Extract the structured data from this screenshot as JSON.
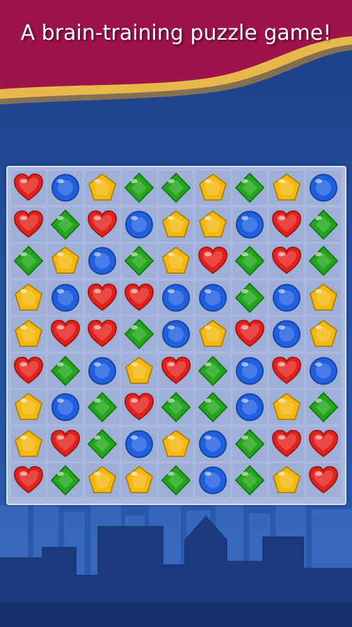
{
  "banner": {
    "tagline": "A brain-training puzzle game!",
    "colors": {
      "ribbon": "#a0124a",
      "gold": "#e8b84a"
    }
  },
  "board": {
    "rows": 9,
    "cols": 9,
    "grid": [
      [
        "heart",
        "circle",
        "pentagon",
        "diamond",
        "diamond",
        "pentagon",
        "diamond",
        "pentagon",
        "circle"
      ],
      [
        "heart",
        "diamond",
        "heart",
        "circle",
        "pentagon",
        "pentagon",
        "circle",
        "heart",
        "diamond"
      ],
      [
        "diamond",
        "pentagon",
        "circle",
        "diamond",
        "pentagon",
        "heart",
        "diamond",
        "heart",
        "diamond"
      ],
      [
        "pentagon",
        "circle",
        "heart",
        "heart",
        "circle",
        "circle",
        "diamond",
        "circle",
        "pentagon"
      ],
      [
        "pentagon",
        "heart",
        "heart",
        "diamond",
        "circle",
        "pentagon",
        "heart",
        "circle",
        "pentagon"
      ],
      [
        "heart",
        "diamond",
        "circle",
        "pentagon",
        "heart",
        "diamond",
        "circle",
        "heart",
        "circle"
      ],
      [
        "pentagon",
        "circle",
        "diamond",
        "heart",
        "diamond",
        "diamond",
        "circle",
        "pentagon",
        "diamond"
      ],
      [
        "pentagon",
        "heart",
        "diamond",
        "circle",
        "pentagon",
        "circle",
        "diamond",
        "heart",
        "heart"
      ],
      [
        "heart",
        "diamond",
        "pentagon",
        "pentagon",
        "diamond",
        "circle",
        "diamond",
        "pentagon",
        "heart"
      ]
    ],
    "gem_colors": {
      "heart": "#e3211c",
      "circle": "#1f5fe0",
      "pentagon": "#f5b80e",
      "diamond": "#22a61c"
    },
    "gem_icons": {
      "heart": "red-heart-gem-icon",
      "circle": "blue-round-gem-icon",
      "pentagon": "yellow-pentagon-gem-icon",
      "diamond": "green-diamond-gem-icon"
    }
  }
}
